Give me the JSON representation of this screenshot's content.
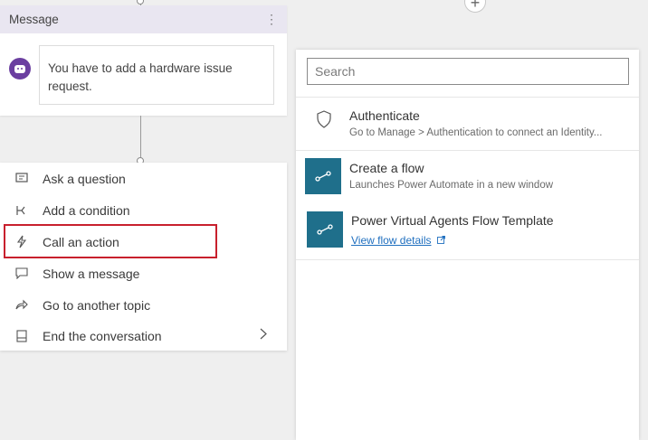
{
  "canvas": {
    "add_node_symbol": "+"
  },
  "message_node": {
    "title": "Message",
    "menu_glyph": "⋮",
    "bubble_text": "You have to add a hardware issue request."
  },
  "add_menu": {
    "items": [
      {
        "label": "Ask a question",
        "icon": "question-bubble-icon"
      },
      {
        "label": "Add a condition",
        "icon": "branch-icon"
      },
      {
        "label": "Call an action",
        "icon": "lightning-icon",
        "highlighted": true
      },
      {
        "label": "Show a message",
        "icon": "message-icon"
      },
      {
        "label": "Go to another topic",
        "icon": "redirect-arrow-icon"
      },
      {
        "label": "End the conversation",
        "icon": "end-icon",
        "has_submenu": true
      }
    ]
  },
  "action_panel": {
    "search_placeholder": "Search",
    "actions": [
      {
        "title": "Authenticate",
        "subtitle": "Go to Manage > Authentication to connect an Identity...",
        "icon": "shield-icon"
      },
      {
        "title": "Create a flow",
        "subtitle": "Launches Power Automate in a new window",
        "icon": "flow-icon"
      },
      {
        "title": "Power Virtual Agents Flow Template",
        "link_label": "View flow details",
        "icon": "flow-icon"
      }
    ]
  },
  "colors": {
    "header_bg": "#e9e6f1",
    "bot_avatar": "#6b3fa0",
    "highlight_border": "#c8202d",
    "flow_tile": "#1f6f8b",
    "link": "#1f6fbf"
  }
}
